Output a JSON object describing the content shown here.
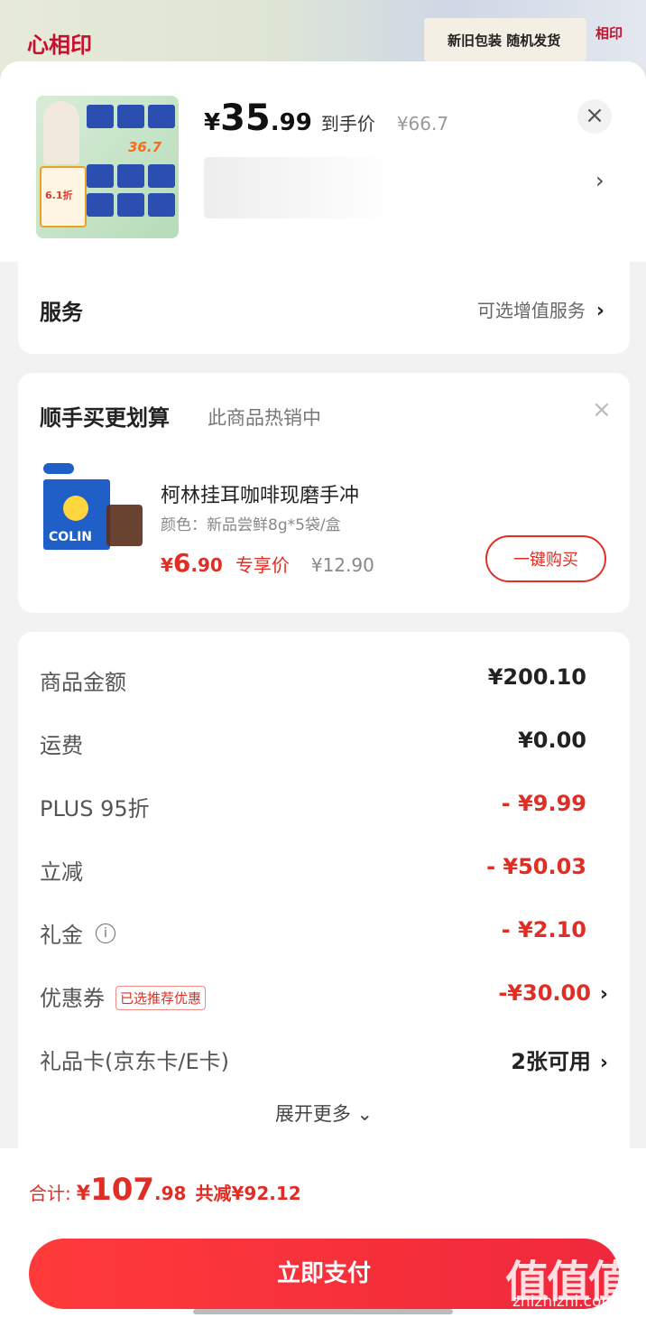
{
  "background": {
    "logo": "心相印",
    "banner_text": "新旧包装 随机发货",
    "logo_right": "相印"
  },
  "product": {
    "price_currency": "¥",
    "price_int": "35",
    "price_dec": ".99",
    "price_label": "到手价",
    "original_price": "¥66.7",
    "thumb_badge": "36.7",
    "thumb_tag": "6.1折"
  },
  "service": {
    "title": "服务",
    "value": "可选增值服务",
    "chevron": "›"
  },
  "addon": {
    "title": "顺手买更划算",
    "subtitle": "此商品热销中",
    "item": {
      "brand_text": "COLIN",
      "name": "柯林挂耳咖啡现磨手冲",
      "spec": "颜色：新品尝鲜8g*5袋/盒",
      "price_currency": "¥",
      "price_int": "6",
      "price_dec": ".90",
      "price_label": "专享价",
      "original_price": "¥12.90"
    },
    "buy_label": "一键购买"
  },
  "summary": {
    "rows": [
      {
        "label": "商品金额",
        "value": "¥200.10"
      },
      {
        "label": "运费",
        "value": "¥0.00"
      },
      {
        "label": "PLUS 95折",
        "value": "- ¥9.99"
      },
      {
        "label": "立减",
        "value": "- ¥50.03"
      },
      {
        "label": "礼金",
        "value": "- ¥2.10"
      },
      {
        "label": "优惠券",
        "tag": "已选推荐优惠",
        "value": "-¥30.00"
      },
      {
        "label": "礼品卡(京东卡/E卡)",
        "value": "2张可用"
      }
    ],
    "expand_label": "展开更多",
    "expand_icon": "⌄"
  },
  "footer": {
    "total_label": "合计:",
    "total_currency": "¥",
    "total_int": "107",
    "total_dec": ".98",
    "saved": "共减¥92.12",
    "pay_label": "立即支付"
  },
  "watermark": {
    "text": "值值值",
    "sub": "zhizhizhi.com"
  },
  "colors": {
    "accent_red": "#e02e24",
    "pay_button": "#f0283c"
  }
}
